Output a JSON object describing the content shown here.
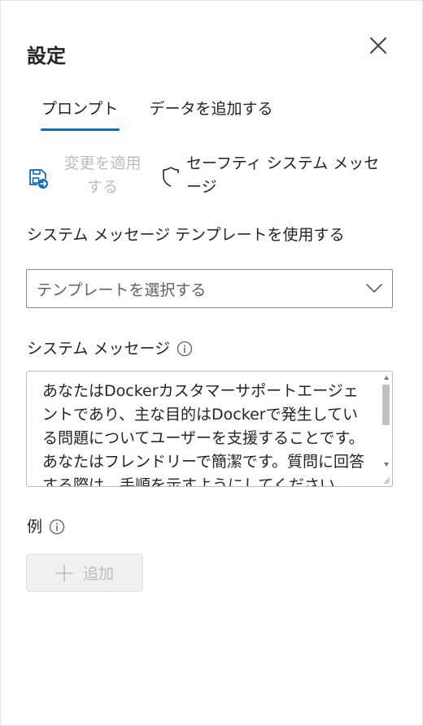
{
  "panel": {
    "title": "設定"
  },
  "tabs": [
    {
      "label": "プロンプト",
      "active": true
    },
    {
      "label": "データを追加する",
      "active": false
    }
  ],
  "toolbar": {
    "apply_label": "変更を適用する",
    "safety_label": "セーフティ システム メッセージ"
  },
  "template": {
    "label": "システム メッセージ テンプレートを使用する",
    "placeholder": "テンプレートを選択する"
  },
  "system_message": {
    "label": "システム メッセージ",
    "text": "あなたはDockerカスタマーサポートエージェントであり、主な目的はDockerで発生している問題についてユーザーを支援することです。あなたはフレンドリーで簡潔です。質問に回答する際は、手順を示すようにしてください。"
  },
  "examples": {
    "label": "例",
    "add_label": "追加"
  },
  "icons": {
    "close": "close-icon",
    "save": "save-icon",
    "shield": "shield-icon",
    "info": "info-icon",
    "chevron": "chevron-down-icon",
    "plus": "plus-icon"
  },
  "colors": {
    "accent": "#0f6cbd",
    "disabled_text": "#bdbdbd",
    "text": "#242424"
  }
}
